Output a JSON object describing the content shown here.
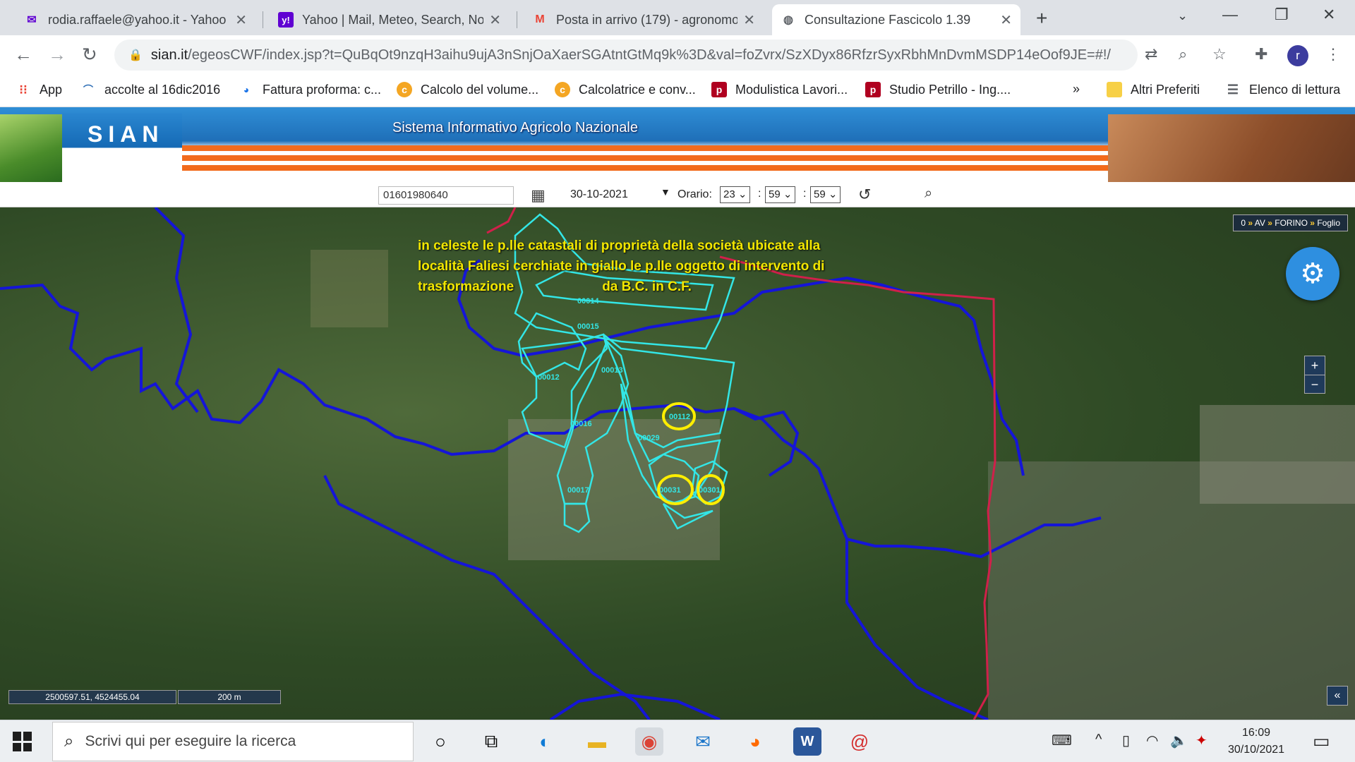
{
  "browser": {
    "tabs": [
      {
        "title": "rodia.raffaele@yahoo.it - Yahoo M",
        "icon": "mail-icon",
        "color": "#6001d2"
      },
      {
        "title": "Yahoo | Mail, Meteo, Search, Noti",
        "icon": "yahoo-icon",
        "color": "#6001d2"
      },
      {
        "title": "Posta in arrivo (179) - agronomo",
        "icon": "gmail-icon",
        "color": "#ea4335"
      },
      {
        "title": "Consultazione Fascicolo 1.39",
        "icon": "globe-icon",
        "color": "#5f6368"
      }
    ],
    "url_host": "sian.it",
    "url_path": "/egeosCWF/index.jsp?t=QuBqOt9nzqH3aihu9ujA3nSnjOaXaerSGAtntGtMq9k%3D&val=foZvrx/SzXDyx86RfzrSyxRbhMnDvmMSDP14eOof9JE=#!/",
    "avatar_letter": "r",
    "bookmarks": [
      {
        "label": "App"
      },
      {
        "label": "accolte al 16dic2016"
      },
      {
        "label": "Fattura proforma: c..."
      },
      {
        "label": "Calcolo del volume..."
      },
      {
        "label": "Calcolatrice e conv..."
      },
      {
        "label": "Modulistica Lavori..."
      },
      {
        "label": "Studio Petrillo - Ing...."
      }
    ],
    "bookmarks_more": "»",
    "bookmarks_other": "Altri Preferiti",
    "reading_list": "Elenco di lettura"
  },
  "sian": {
    "logo": "SIAN",
    "title": "Sistema Informativo Agricolo Nazionale",
    "cuaa": "01601980640",
    "date": "30-10-2021",
    "orario_label": "Orario:",
    "hour": "23",
    "minute": "59",
    "second": "59"
  },
  "map": {
    "breadcrumb": [
      "0",
      "AV",
      "FORINO",
      "Foglio"
    ],
    "annotation_line1": "in celeste le p.lle catastali di proprietà della società ubicate alla",
    "annotation_line2": "località Faliesi cerchiate in giallo le p.lle oggetto di intervento di",
    "annotation_line3a": "trasformazione",
    "annotation_line3b": "da B.C. in C.F.",
    "parcels": [
      "00014",
      "00015",
      "00012",
      "00013",
      "00112",
      "00016",
      "00029",
      "00017",
      "00031",
      "00301"
    ],
    "highlighted": [
      "00112",
      "00031",
      "00301"
    ],
    "coords": "2500597.51, 4524455.04",
    "scale": "200 m",
    "zoom_in": "+",
    "zoom_out": "−",
    "collapse": "«",
    "colors": {
      "parcel": "#33e6e6",
      "circle": "#ffee00",
      "boundary_blue": "#1010d0",
      "boundary_red": "#d0204a"
    }
  },
  "taskbar": {
    "search_placeholder": "Scrivi qui per eseguire la ricerca",
    "time": "16:09",
    "date": "30/10/2021"
  }
}
